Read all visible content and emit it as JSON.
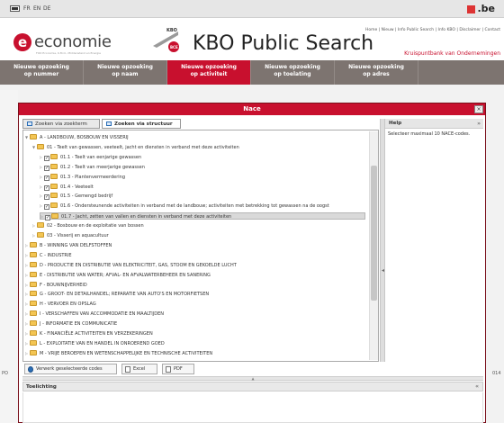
{
  "langbar": {
    "languages": [
      "FR",
      "EN",
      "DE"
    ],
    "logo_text": ".be"
  },
  "header": {
    "brand": "economie",
    "brand_sub": "FOD Economie, K.M.O., Middenstand en Energie",
    "kbo_mark_top": "KBO",
    "kbo_mark_bottom": "BCE",
    "title": "KBO Public Search",
    "links": "Home | Nieuw | Info Public Search | Info KBO | Disclaimer | Contact",
    "tagline": "Kruispuntbank van Ondernemingen"
  },
  "nav": {
    "items": [
      {
        "line1": "Nieuwe opzoeking",
        "line2": "op nummer"
      },
      {
        "line1": "Nieuwe opzoeking",
        "line2": "op naam"
      },
      {
        "line1": "Nieuwe opzoeking",
        "line2": "op activiteit"
      },
      {
        "line1": "Nieuwe opzoeking",
        "line2": "op toelating"
      },
      {
        "line1": "Nieuwe opzoeking",
        "line2": "op adres"
      }
    ]
  },
  "side": {
    "left_text": "PO",
    "right_text": "014"
  },
  "modal": {
    "title": "Nace",
    "close": "×",
    "tabs": [
      "Zoeken via zoekterm",
      "Zoeken via structuur"
    ],
    "help_title": "Help",
    "help_collapse": "»",
    "help_text": "Selecteer maximaal 10 NACE-codes.",
    "tree": [
      {
        "label": "A - LANDBOUW, BOSBOUW EN VISSERIJ",
        "arrow": "▼"
      },
      {
        "label": "01 - Teelt van gewassen, veeteelt, jacht en diensten in verband met deze activiteiten",
        "arrow": "▼"
      },
      {
        "label": "01.1 - Teelt van eenjarige gewassen",
        "arrow": "▷",
        "check": "✓"
      },
      {
        "label": "01.2 - Teelt van meerjarige gewassen",
        "arrow": "▷",
        "check": "✓"
      },
      {
        "label": "01.3 - Plantenvermeerdering",
        "arrow": "▷",
        "check": "✓"
      },
      {
        "label": "01.4 - Veeteelt",
        "arrow": "▷",
        "check": "✓"
      },
      {
        "label": "01.5 - Gemengd bedrijf",
        "arrow": "▷",
        "check": "✓"
      },
      {
        "label": "01.6 - Ondersteunende activiteiten in verband met de landbouw; activiteiten met betrekking tot gewassen na de oogst",
        "arrow": "▷",
        "check": "✓"
      },
      {
        "label": "01.7 - Jacht, zetten van vallen en diensten in verband met deze activiteiten",
        "arrow": "▷",
        "check": "✓"
      },
      {
        "label": "02 - Bosbouw en de exploitatie van bossen",
        "arrow": "▷"
      },
      {
        "label": "03 - Visserij en aquacultuur",
        "arrow": "▷"
      },
      {
        "label": "B - WINNING VAN DELFSTOFFEN",
        "arrow": "▷"
      },
      {
        "label": "C - INDUSTRIE",
        "arrow": "▷"
      },
      {
        "label": "D - PRODUCTIE EN DISTRIBUTIE VAN ELEKTRICITEIT, GAS, STOOM EN GEKOELDE LUCHT",
        "arrow": "▷"
      },
      {
        "label": "E - DISTRIBUTIE VAN WATER; AFVAL- EN AFVALWATERBEHEER EN SANERING",
        "arrow": "▷"
      },
      {
        "label": "F - BOUWNIJVERHEID",
        "arrow": "▷"
      },
      {
        "label": "G - GROOT- EN DETAILHANDEL; REPARATIE VAN AUTO'S EN MOTORFIETSEN",
        "arrow": "▷"
      },
      {
        "label": "H - VERVOER EN OPSLAG",
        "arrow": "▷"
      },
      {
        "label": "I - VERSCHAFFEN VAN ACCOMMODATIE EN MAALTIJDEN",
        "arrow": "▷"
      },
      {
        "label": "J - INFORMATIE EN COMMUNICATIE",
        "arrow": "▷"
      },
      {
        "label": "K - FINANCIËLE ACTIVITEITEN EN VERZEKERINGEN",
        "arrow": "▷"
      },
      {
        "label": "L - EXPLOITATIE VAN EN HANDEL IN ONROEREND GOED",
        "arrow": "▷"
      },
      {
        "label": "M - VRIJE BEROEPEN EN WETENSCHAPPELIJKE EN TECHNISCHE ACTIVITEITEN",
        "arrow": "▷"
      }
    ],
    "buttons": {
      "apply": "Verwerk geselecteerde codes",
      "excel": "Excel",
      "pdf": "PDF"
    },
    "divider_handle": "▲",
    "split_arrow": "◂",
    "explanation_title": "Toelichting",
    "explanation_collapse": "«"
  },
  "colors": {
    "brand_red": "#c8102e",
    "nav_grey": "#7d7470",
    "folder_yellow": "#f3c553"
  }
}
